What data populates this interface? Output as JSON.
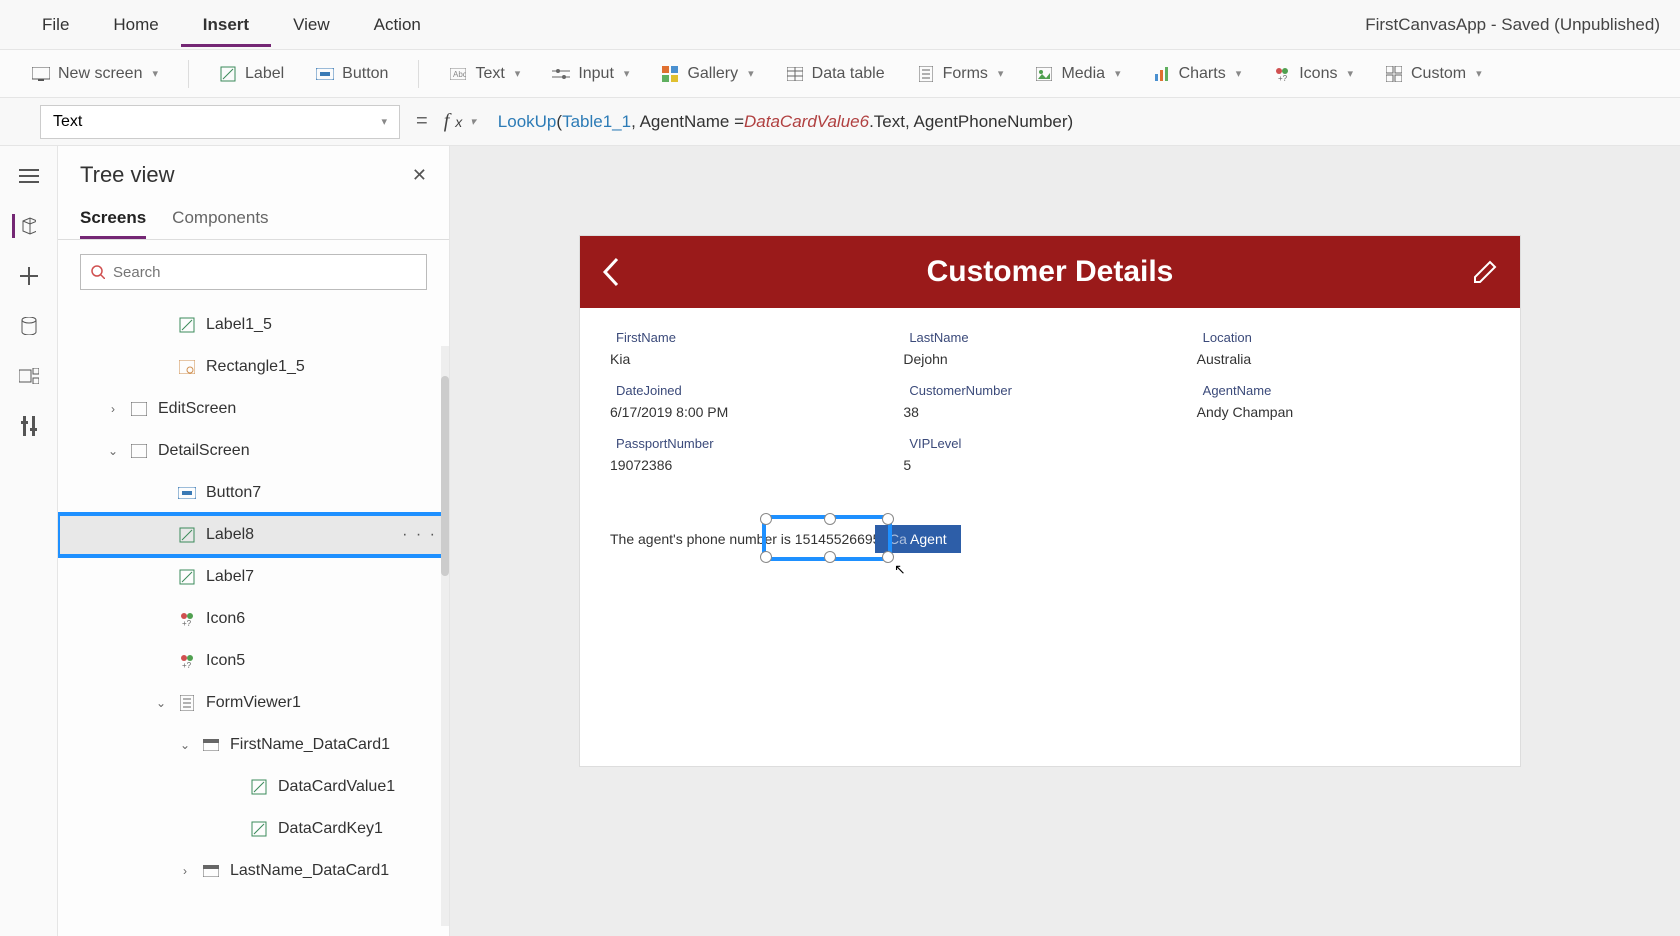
{
  "menubar": [
    "File",
    "Home",
    "Insert",
    "View",
    "Action"
  ],
  "menubar_active": "Insert",
  "app_title": "FirstCanvasApp - Saved (Unpublished)",
  "ribbon": {
    "new_screen": "New screen",
    "label": "Label",
    "button": "Button",
    "text": "Text",
    "input": "Input",
    "gallery": "Gallery",
    "data_table": "Data table",
    "forms": "Forms",
    "media": "Media",
    "charts": "Charts",
    "icons": "Icons",
    "custom": "Custom"
  },
  "property_selector": "Text",
  "formula": {
    "fn": "LookUp",
    "args_ref1": "Table1_1",
    "args_plain1": ", AgentName = ",
    "args_ref2": "DataCardValue6",
    "args_plain2": ".Text, AgentPhoneNumber)"
  },
  "tree": {
    "title": "Tree view",
    "tabs": [
      "Screens",
      "Components"
    ],
    "active_tab": "Screens",
    "search_placeholder": "Search",
    "items": [
      {
        "label": "Label1_5",
        "indent": 2,
        "icon": "label"
      },
      {
        "label": "Rectangle1_5",
        "indent": 2,
        "icon": "rect"
      },
      {
        "label": "EditScreen",
        "indent": 0,
        "icon": "screen",
        "chev": "›"
      },
      {
        "label": "DetailScreen",
        "indent": 0,
        "icon": "screen",
        "chev": "⌄"
      },
      {
        "label": "Button7",
        "indent": 2,
        "icon": "button"
      },
      {
        "label": "Label8",
        "indent": 2,
        "icon": "label",
        "selected": true,
        "more": "· · ·"
      },
      {
        "label": "Label7",
        "indent": 2,
        "icon": "label"
      },
      {
        "label": "Icon6",
        "indent": 2,
        "icon": "icon"
      },
      {
        "label": "Icon5",
        "indent": 2,
        "icon": "icon"
      },
      {
        "label": "FormViewer1",
        "indent": 2,
        "icon": "form",
        "chev": "⌄"
      },
      {
        "label": "FirstName_DataCard1",
        "indent": 3,
        "icon": "card",
        "chev": "⌄"
      },
      {
        "label": "DataCardValue1",
        "indent": 5,
        "icon": "label"
      },
      {
        "label": "DataCardKey1",
        "indent": 5,
        "icon": "label"
      },
      {
        "label": "LastName_DataCard1",
        "indent": 3,
        "icon": "card",
        "chev": "›"
      }
    ]
  },
  "canvas": {
    "header_title": "Customer Details",
    "fields": [
      {
        "label": "FirstName",
        "value": "Kia"
      },
      {
        "label": "LastName",
        "value": "Dejohn"
      },
      {
        "label": "Location",
        "value": "Australia"
      },
      {
        "label": "DateJoined",
        "value": "6/17/2019 8:00 PM"
      },
      {
        "label": "CustomerNumber",
        "value": "38"
      },
      {
        "label": "AgentName",
        "value": "Andy Champan"
      },
      {
        "label": "PassportNumber",
        "value": "19072386"
      },
      {
        "label": "VIPLevel",
        "value": "5"
      }
    ],
    "agent_prefix": "The agent's phone number is ",
    "agent_phone": "15145526695",
    "agent_button": "Agent"
  }
}
